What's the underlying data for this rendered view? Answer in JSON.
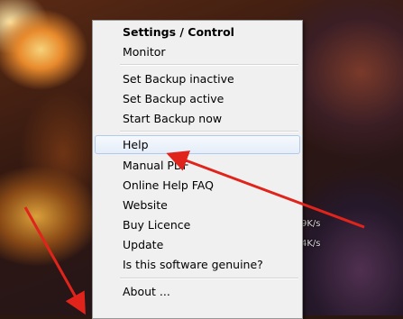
{
  "context_menu": {
    "header": "Settings / Control",
    "items": [
      {
        "label": "Monitor"
      },
      {
        "label": "Set Backup inactive"
      },
      {
        "label": "Set Backup active"
      },
      {
        "label": "Start Backup now"
      },
      {
        "label": "Help"
      },
      {
        "label": "Manual PDF"
      },
      {
        "label": "Online Help FAQ"
      },
      {
        "label": "Website"
      },
      {
        "label": "Buy Licence"
      },
      {
        "label": "Update"
      },
      {
        "label": "Is this software genuine?"
      },
      {
        "label": "About ..."
      }
    ],
    "highlighted_item": "Help"
  },
  "desktop_overlay": {
    "upload_rate": "9K/s",
    "download_rate": "4K/s"
  },
  "annotations": {
    "arrow_color": "#e0241b"
  }
}
